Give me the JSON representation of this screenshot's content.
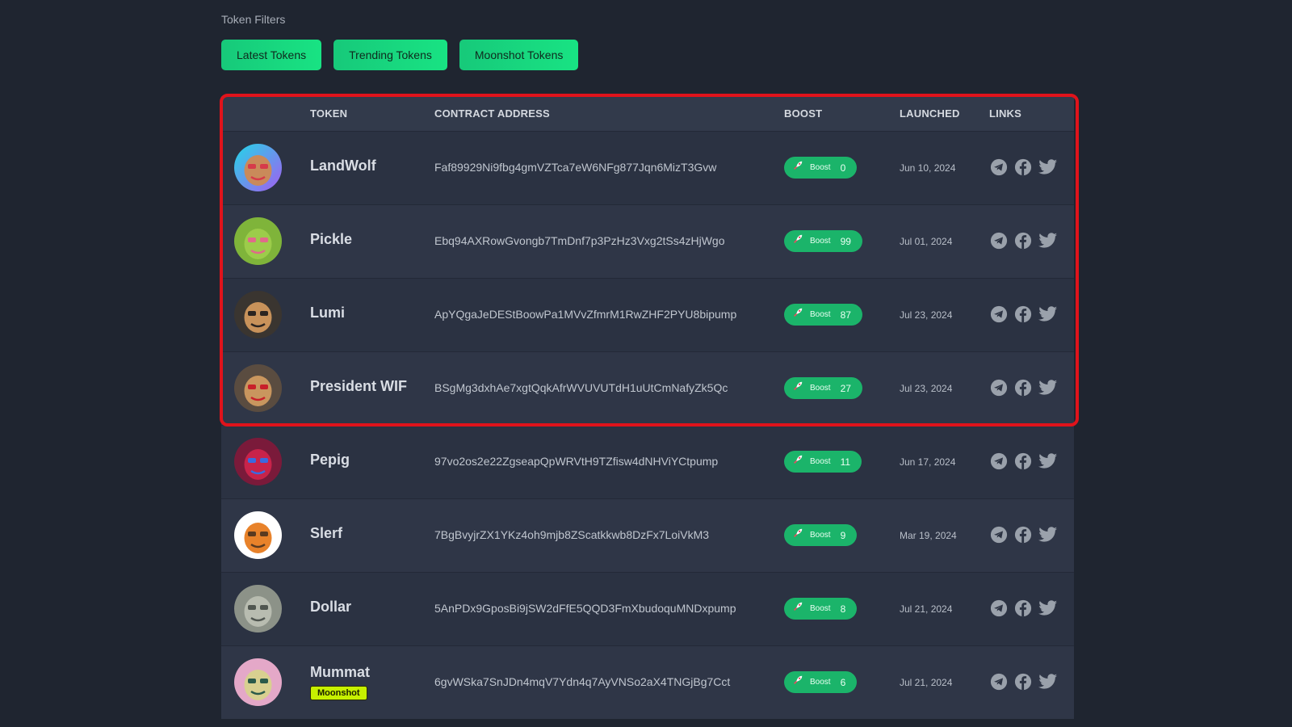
{
  "filters": {
    "label": "Token Filters",
    "buttons": [
      "Latest Tokens",
      "Trending Tokens",
      "Moonshot Tokens"
    ]
  },
  "table": {
    "headers": {
      "token": "TOKEN",
      "contract": "CONTRACT ADDRESS",
      "boost": "BOOST",
      "launched": "LAUNCHED",
      "links": "LINKS"
    },
    "boost_label": "Boost",
    "rows": [
      {
        "name": "LandWolf",
        "address": "Faf89929Ni9fbg4gmVZTca7eW6NFg877Jqn6MizT3Gvw",
        "boost": "0",
        "launched": "Jun 10, 2024",
        "avatar": "landwolf-avatar"
      },
      {
        "name": "Pickle",
        "address": "Ebq94AXRowGvongb7TmDnf7p3PzHz3Vxg2tSs4zHjWgo",
        "boost": "99",
        "launched": "Jul 01, 2024",
        "avatar": "pickle-avatar"
      },
      {
        "name": "Lumi",
        "address": "ApYQgaJeDEStBoowPa1MVvZfmrM1RwZHF2PYU8bipump",
        "boost": "87",
        "launched": "Jul 23, 2024",
        "avatar": "lumi-avatar"
      },
      {
        "name": "President WIF",
        "address": "BSgMg3dxhAe7xgtQqkAfrWVUVUTdH1uUtCmNafyZk5Qc",
        "boost": "27",
        "launched": "Jul 23, 2024",
        "avatar": "president-wif-avatar"
      },
      {
        "name": "Pepig",
        "address": "97vo2os2e22ZgseapQpWRVtH9TZfisw4dNHViYCtpump",
        "boost": "11",
        "launched": "Jun 17, 2024",
        "avatar": "pepig-avatar"
      },
      {
        "name": "Slerf",
        "address": "7BgBvyjrZX1YKz4oh9mjb8ZScatkkwb8DzFx7LoiVkM3",
        "boost": "9",
        "launched": "Mar 19, 2024",
        "avatar": "slerf-avatar"
      },
      {
        "name": "Dollar",
        "address": "5AnPDx9GposBi9jSW2dFfE5QQD3FmXbudoquMNDxpump",
        "boost": "8",
        "launched": "Jul 21, 2024",
        "avatar": "dollar-avatar"
      },
      {
        "name": "Mummat",
        "badge": "Moonshot",
        "address": "6gvWSka7SnJDn4mqV7Ydn4q7AyVNSo2aX4TNGjBg7Cct",
        "boost": "6",
        "launched": "Jul 21, 2024",
        "avatar": "mummat-avatar"
      }
    ]
  },
  "colors": {
    "background": "#1f2530",
    "accent_green": "#18e383",
    "highlight_red": "#e0131b",
    "moonshot_badge": "#c7f000"
  },
  "icons": [
    "rocket-icon",
    "telegram-icon",
    "facebook-icon",
    "twitter-icon"
  ]
}
